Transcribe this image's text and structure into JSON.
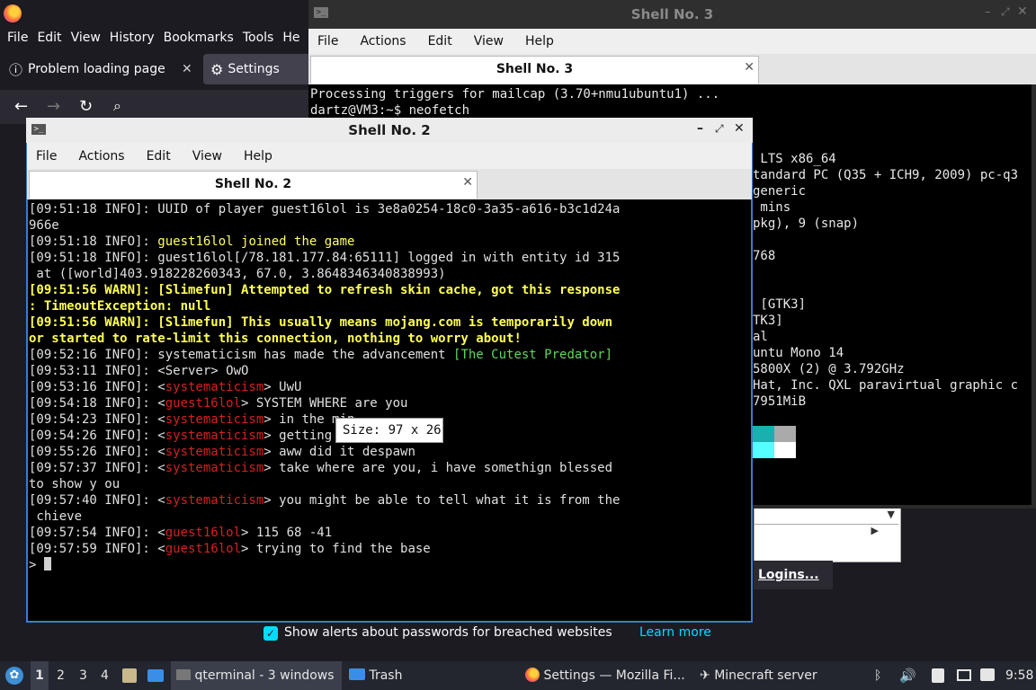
{
  "firefox": {
    "menu": [
      "File",
      "Edit",
      "View",
      "History",
      "Bookmarks",
      "Tools",
      "He"
    ],
    "tabs": [
      {
        "label": "Problem loading page"
      },
      {
        "label": "Settings"
      }
    ],
    "breach_label": "Show alerts about passwords for breached websites",
    "learn_more": "Learn more",
    "logins_button": "Logins..."
  },
  "shell3": {
    "title": "Shell No. 3",
    "menu": [
      "File",
      "Actions",
      "Edit",
      "View",
      "Help"
    ],
    "tab_label": "Shell No. 3",
    "lines": [
      "Processing triggers for mailcap (3.70+nmu1ubuntu1) ...",
      "dartz@VM3:~$ neofetch",
      "",
      "",
      " LTS x86_64",
      "tandard PC (Q35 + ICH9, 2009) pc-q3",
      "generic",
      " mins",
      "pkg), 9 (snap)",
      "",
      "768",
      "",
      "",
      " [GTK3]",
      "TK3]",
      "al",
      "untu Mono 14",
      "5800X (2) @ 3.792GHz",
      "Hat, Inc. QXL paravirtual graphic c",
      "7951MiB"
    ]
  },
  "shell2": {
    "title": "Shell No. 2",
    "menu": [
      "File",
      "Actions",
      "Edit",
      "View",
      "Help"
    ],
    "tab_label": "Shell No. 2",
    "log": [
      {
        "t": "[09:51:18 INFO]: UUID of player guest16lol is 3e8a0254-18c0-3a35-a616-b3c1d24a"
      },
      {
        "t": "966e"
      },
      {
        "t": "[09:51:18 INFO]: ",
        "y": "guest16lol joined the game"
      },
      {
        "t": "[09:51:18 INFO]: guest16lol[/78.181.177.84:65111] logged in with entity id 315"
      },
      {
        "t": " at ([world]403.918228260343, 67.0, 3.8648346340838993)"
      },
      {
        "w": "[09:51:56 WARN]: [Slimefun] Attempted to refresh skin cache, got this response"
      },
      {
        "w": ": TimeoutException: null"
      },
      {
        "w": "[09:51:56 WARN]: [Slimefun] This usually means mojang.com is temporarily down"
      },
      {
        "w": "or started to rate-limit this connection, nothing to worry about!"
      },
      {
        "t": "[09:52:16 INFO]: systematicism has made the advancement ",
        "g": "[The Cutest Predator]"
      },
      {
        "t": "[09:53:11 INFO]: <Server> OwO"
      },
      {
        "t": "[09:53:16 INFO]: <",
        "r": "systematicism",
        "t2": "> UwU"
      },
      {
        "t": "[09:54:18 INFO]: <",
        "r": "guest16lol",
        "t2": "> SYSTEM WHERE are you"
      },
      {
        "t": "[09:54:23 INFO]: <",
        "r": "systematicism",
        "t2": "> in the min"
      },
      {
        "t": "[09:54:26 INFO]: <",
        "r": "systematicism",
        "t2": "> getting a"
      },
      {
        "t": "[09:55:26 INFO]: <",
        "r": "systematicism",
        "t2": "> aww did it despawn"
      },
      {
        "t": "[09:57:37 INFO]: <",
        "r": "systematicism",
        "t2": "> take where are you, i have somethign blessed"
      },
      {
        "t": "to show y ou"
      },
      {
        "t": "[09:57:40 INFO]: <",
        "r": "systematicism",
        "t2": "> you might be able to tell what it is from the"
      },
      {
        "t": " chieve"
      },
      {
        "t": "[09:57:54 INFO]: <",
        "r": "guest16lol",
        "t2": "> 115 68 -41"
      },
      {
        "t": "[09:57:59 INFO]: <",
        "r": "guest16lol",
        "t2": "> trying to find the base"
      }
    ],
    "prompt": ">"
  },
  "tooltip": "Size: 97 x 26",
  "taskbar": {
    "workspaces": [
      "1",
      "2",
      "3",
      "4"
    ],
    "qterminal": "qterminal - 3 windows",
    "trash": "Trash",
    "firefox": "Settings — Mozilla Fi...",
    "minecraft": "Minecraft server",
    "clock": "9:58"
  }
}
